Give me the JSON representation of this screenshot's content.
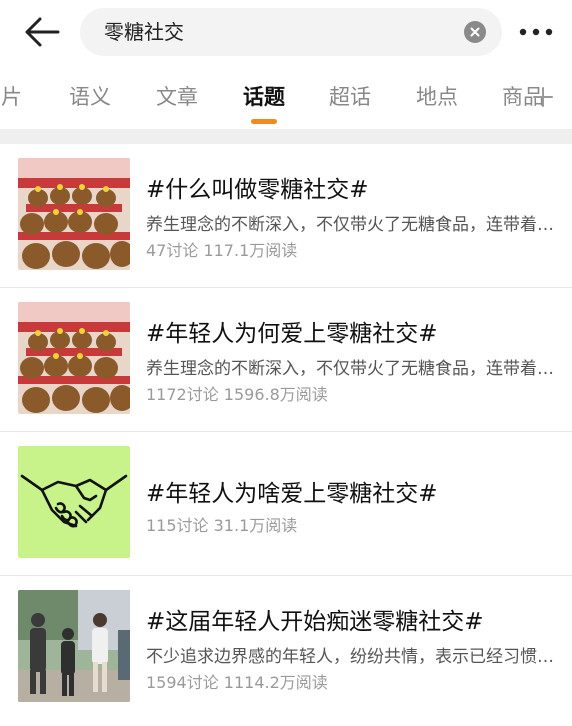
{
  "search": {
    "query": "零糖社交"
  },
  "tabs": [
    {
      "label": "图片",
      "active": false
    },
    {
      "label": "语义",
      "active": false
    },
    {
      "label": "文章",
      "active": false
    },
    {
      "label": "话题",
      "active": true
    },
    {
      "label": "超话",
      "active": false
    },
    {
      "label": "地点",
      "active": false
    },
    {
      "label": "商品",
      "active": false
    }
  ],
  "colors": {
    "accent": "#f28a1e",
    "thumb_green": "#c8f28a"
  },
  "topics": [
    {
      "title": "#什么叫做零糖社交#",
      "desc": "养生理念的不断深入，不仅带火了无糖食品，连带着社交也开始“零糖”起来",
      "meta": "47讨论 117.1万阅读",
      "thumbnail": "capybara-plush-display"
    },
    {
      "title": "#年轻人为何爱上零糖社交#",
      "desc": "养生理念的不断深入，不仅带火了无糖食品，连带着社交也开始“零糖”起来",
      "meta": "1172讨论 1596.8万阅读",
      "thumbnail": "capybara-plush-display"
    },
    {
      "title": "#年轻人为啥爱上零糖社交#",
      "desc": "",
      "meta": "115讨论 31.1万阅读",
      "thumbnail": "handshake-illustration"
    },
    {
      "title": "#这届年轻人开始痴迷零糖社交#",
      "desc": "不少追求边界感的年轻人，纷纷共情，表示已经习惯这种社交方式",
      "meta": "1594讨论 1114.2万阅读",
      "thumbnail": "young-people-photo"
    }
  ]
}
